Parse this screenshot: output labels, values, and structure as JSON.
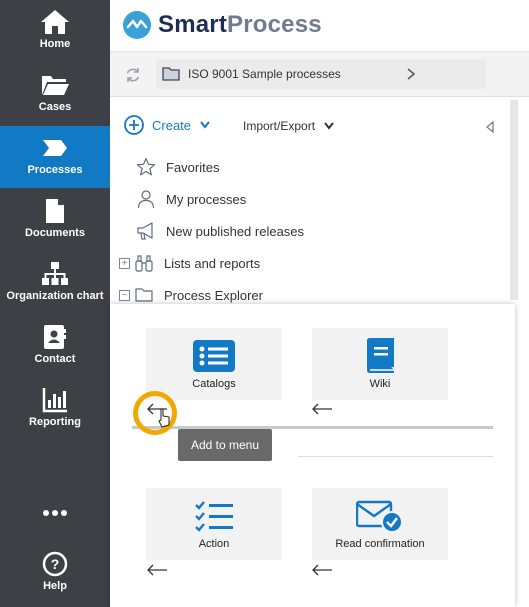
{
  "sidebar": {
    "items": [
      {
        "label": "Home",
        "icon": "home-icon"
      },
      {
        "label": "Cases",
        "icon": "folder-open-icon"
      },
      {
        "label": "Processes",
        "icon": "process-chevron-icon",
        "active": true
      },
      {
        "label": "Documents",
        "icon": "document-icon"
      },
      {
        "label": "Organization chart",
        "icon": "org-chart-icon"
      },
      {
        "label": "Contact",
        "icon": "contact-card-icon"
      },
      {
        "label": "Reporting",
        "icon": "bar-chart-icon"
      },
      {
        "label": "",
        "icon": "more-dots-icon"
      },
      {
        "label": "Help",
        "icon": "help-circle-icon"
      }
    ]
  },
  "header": {
    "logo_part1": "Smart",
    "logo_part2": "Process"
  },
  "breadcrumb": {
    "path": "ISO 9001 Sample processes"
  },
  "toolbar": {
    "create_label": "Create",
    "import_label": "Import/Export"
  },
  "tree": {
    "items": [
      {
        "label": "Favorites",
        "icon": "star-icon"
      },
      {
        "label": "My processes",
        "icon": "user-icon"
      },
      {
        "label": "New published releases",
        "icon": "megaphone-icon"
      },
      {
        "label": "Lists and reports",
        "icon": "binoculars-icon",
        "expander": "+"
      },
      {
        "label": "Process Explorer",
        "icon": "folder-icon",
        "expander": "−"
      }
    ]
  },
  "popup": {
    "tiles": [
      {
        "label": "Catalogs",
        "icon": "catalog-list-icon"
      },
      {
        "label": "Wiki",
        "icon": "book-icon"
      },
      {
        "label": "Action",
        "icon": "checklist-icon"
      },
      {
        "label": "Read confirmation",
        "icon": "mail-check-icon"
      }
    ],
    "tooltip": "Add to menu"
  },
  "colors": {
    "sidebar_bg": "#3d4045",
    "accent": "#1279c4",
    "cursor_ring": "#f1a800"
  }
}
